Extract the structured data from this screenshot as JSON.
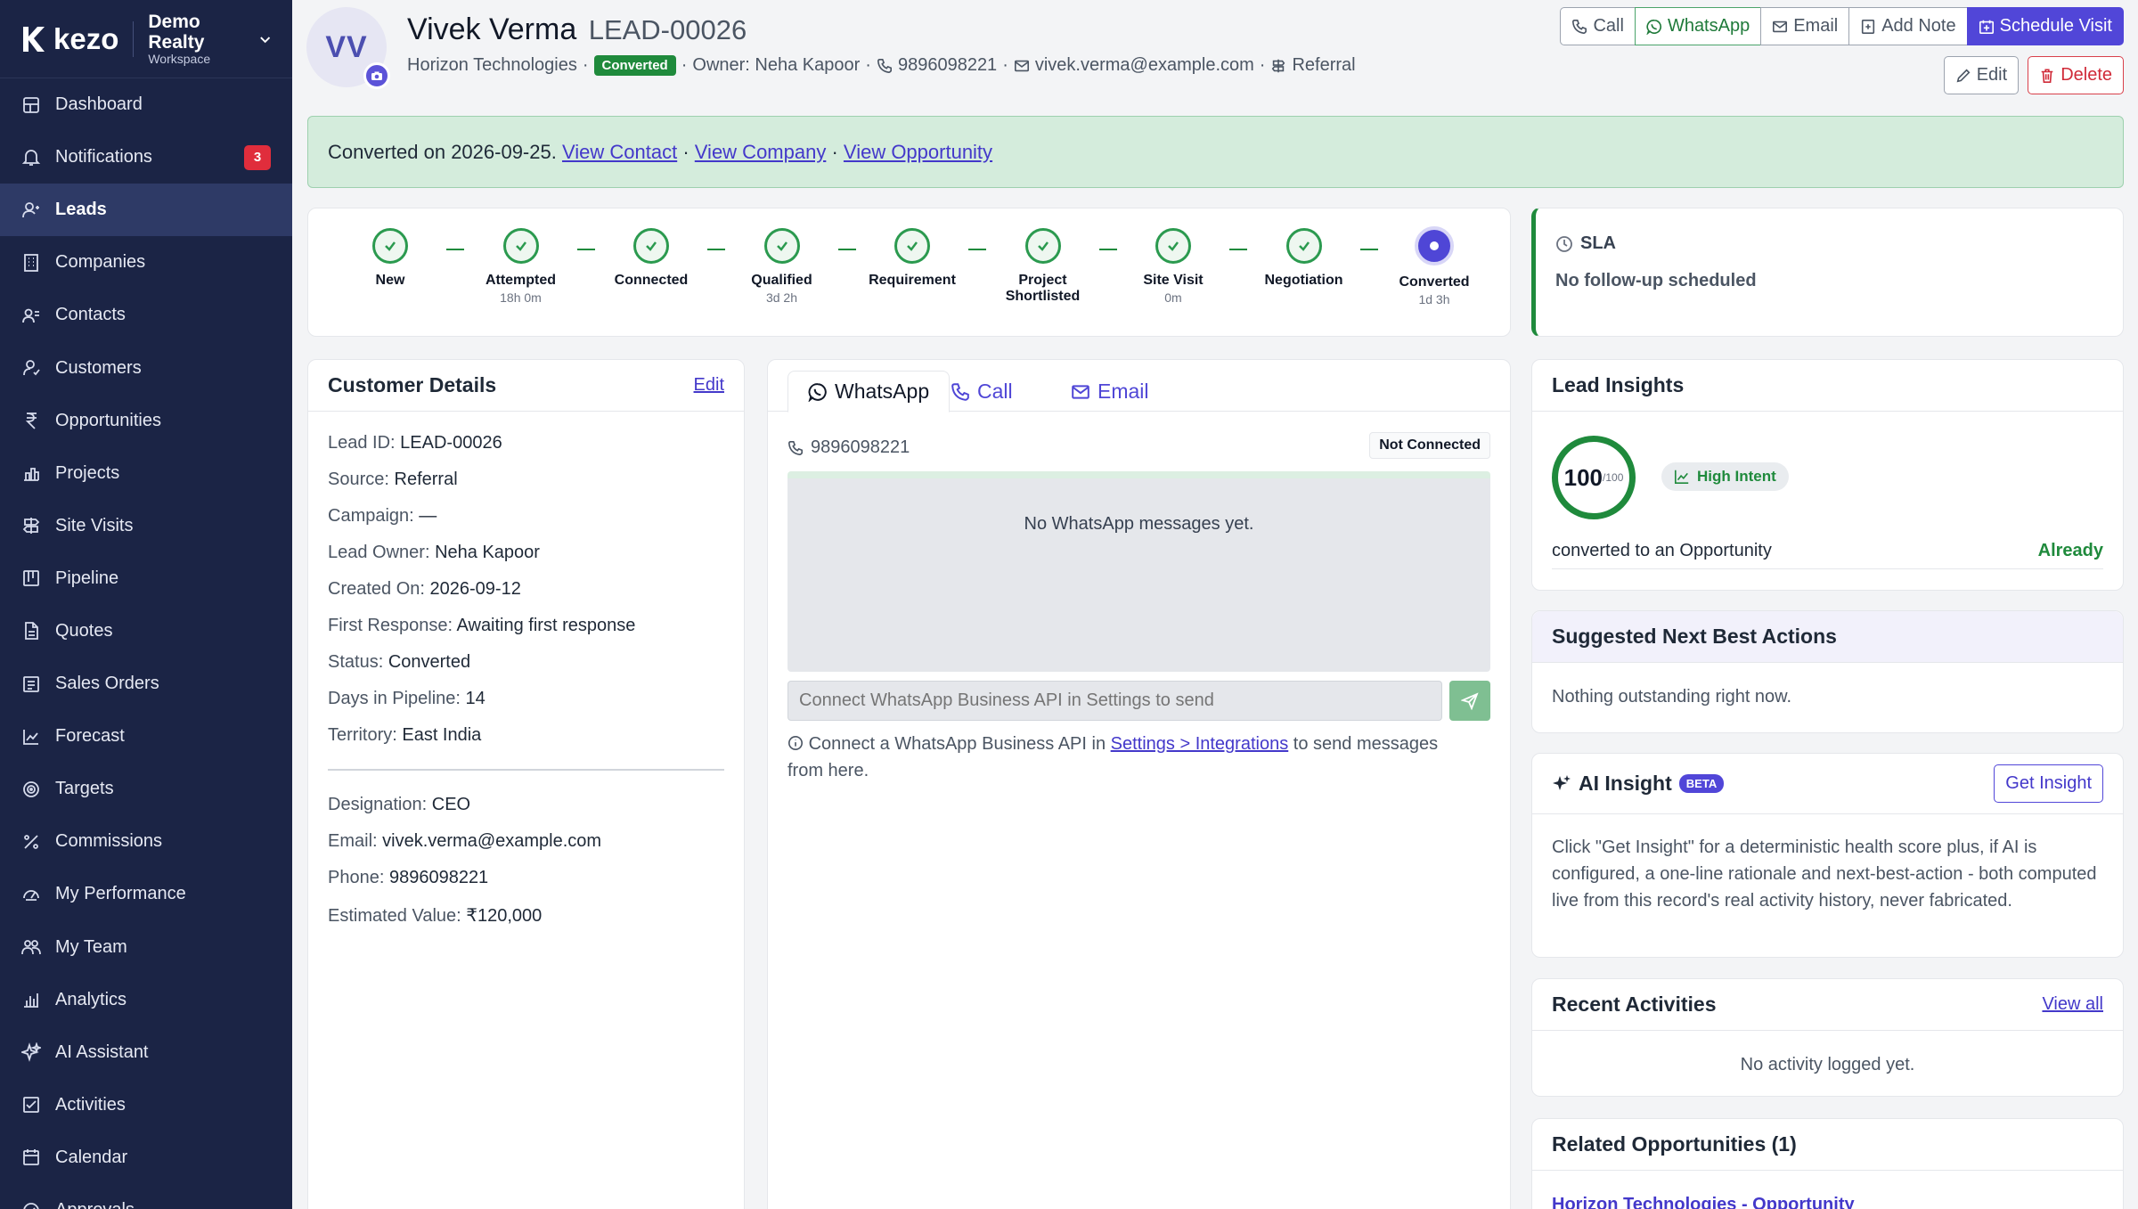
{
  "brand": {
    "name": "kezo",
    "workspace_name": "Demo Realty",
    "workspace_sub": "Workspace"
  },
  "sidebar": {
    "items": [
      {
        "label": "Dashboard",
        "icon": "dashboard-icon"
      },
      {
        "label": "Notifications",
        "icon": "bell-icon",
        "badge": "3"
      },
      {
        "label": "Leads",
        "icon": "leads-icon",
        "active": true
      },
      {
        "label": "Companies",
        "icon": "building-icon"
      },
      {
        "label": "Contacts",
        "icon": "contacts-icon"
      },
      {
        "label": "Customers",
        "icon": "customers-icon"
      },
      {
        "label": "Opportunities",
        "icon": "rupee-icon"
      },
      {
        "label": "Projects",
        "icon": "projects-icon"
      },
      {
        "label": "Site Visits",
        "icon": "signpost-icon"
      },
      {
        "label": "Pipeline",
        "icon": "pipeline-icon"
      },
      {
        "label": "Quotes",
        "icon": "document-icon"
      },
      {
        "label": "Sales Orders",
        "icon": "orders-icon"
      },
      {
        "label": "Forecast",
        "icon": "trend-icon"
      },
      {
        "label": "Targets",
        "icon": "target-icon"
      },
      {
        "label": "Commissions",
        "icon": "percent-icon"
      },
      {
        "label": "My Performance",
        "icon": "gauge-icon"
      },
      {
        "label": "My Team",
        "icon": "team-icon"
      },
      {
        "label": "Analytics",
        "icon": "bar-chart-icon"
      },
      {
        "label": "AI Assistant",
        "icon": "sparkle-icon"
      },
      {
        "label": "Activities",
        "icon": "checklist-icon"
      },
      {
        "label": "Calendar",
        "icon": "calendar-icon"
      },
      {
        "label": "Approvals",
        "icon": "approval-icon"
      }
    ]
  },
  "header": {
    "initials": "VV",
    "name": "Vivek Verma",
    "lead_id": "LEAD-00026",
    "company": "Horizon Technologies",
    "status": "Converted",
    "owner": "Owner: Neha Kapoor",
    "phone": "9896098221",
    "email": "vivek.verma@example.com",
    "source": "Referral",
    "sep": "·",
    "actions": {
      "call": "Call",
      "whatsapp": "WhatsApp",
      "email": "Email",
      "add_note": "Add Note",
      "schedule": "Schedule Visit",
      "edit": "Edit",
      "delete": "Delete"
    }
  },
  "banner": {
    "text": "Converted on 2026-09-25.",
    "link_contact": "View Contact",
    "link_company": "View Company",
    "link_opportunity": "View Opportunity",
    "sep": "·"
  },
  "stages": [
    {
      "label": "New",
      "time": ""
    },
    {
      "label": "Attempted",
      "time": "18h 0m"
    },
    {
      "label": "Connected",
      "time": ""
    },
    {
      "label": "Qualified",
      "time": "3d 2h"
    },
    {
      "label": "Requirement",
      "time": ""
    },
    {
      "label": "Project Shortlisted",
      "time": ""
    },
    {
      "label": "Site Visit",
      "time": "0m"
    },
    {
      "label": "Negotiation",
      "time": ""
    },
    {
      "label": "Converted",
      "time": "1d 3h",
      "current": true
    }
  ],
  "sla": {
    "title": "SLA",
    "text": "No follow-up scheduled"
  },
  "customer": {
    "title": "Customer Details",
    "edit": "Edit",
    "fields": [
      {
        "k": "Lead ID:",
        "v": "LEAD-00026"
      },
      {
        "k": "Source:",
        "v": "Referral"
      },
      {
        "k": "Campaign:",
        "v": "—"
      },
      {
        "k": "Lead Owner:",
        "v": "Neha Kapoor"
      },
      {
        "k": "Created On:",
        "v": "2026-09-12"
      },
      {
        "k": "First Response:",
        "v": "Awaiting first response"
      },
      {
        "k": "Status:",
        "v": "Converted"
      },
      {
        "k": "Days in Pipeline:",
        "v": "14"
      },
      {
        "k": "Territory:",
        "v": "East India"
      },
      {
        "k": "Designation:",
        "v": "CEO"
      },
      {
        "k": "Email:",
        "v": "vivek.verma@example.com"
      },
      {
        "k": "Phone:",
        "v": "9896098221"
      },
      {
        "k": "Estimated Value:",
        "v": "₹120,000"
      }
    ]
  },
  "comms": {
    "tabs": {
      "whatsapp": "WhatsApp",
      "call": "Call",
      "email": "Email"
    },
    "phone": "9896098221",
    "status": "Not Connected",
    "empty": "No WhatsApp messages yet.",
    "input_placeholder": "Connect WhatsApp Business API in Settings to send",
    "note_pre": "Connect a WhatsApp Business API in",
    "note_link": "Settings > Integrations",
    "note_post": "to send messages from here."
  },
  "insights": {
    "title": "Lead Insights",
    "score": "100",
    "score_max": "/100",
    "intent": "High Intent",
    "row_label": "converted to an Opportunity",
    "row_value": "Already"
  },
  "nba": {
    "title": "Suggested Next Best Actions",
    "text": "Nothing outstanding right now."
  },
  "ai": {
    "title": "AI Insight",
    "badge": "BETA",
    "button": "Get Insight",
    "text": "Click \"Get Insight\" for a deterministic health score plus, if AI is configured, a one-line rationale and next-best-action - both computed live from this record's real activity history, never fabricated."
  },
  "recent": {
    "title": "Recent Activities",
    "link": "View all",
    "empty": "No activity logged yet."
  },
  "related": {
    "title": "Related Opportunities (1)",
    "link": "Horizon Technologies - Opportunity"
  },
  "colors": {
    "sidebar": "#1b2445",
    "accent": "#5146d8",
    "success": "#1f8a3c",
    "danger": "#d02a38"
  }
}
